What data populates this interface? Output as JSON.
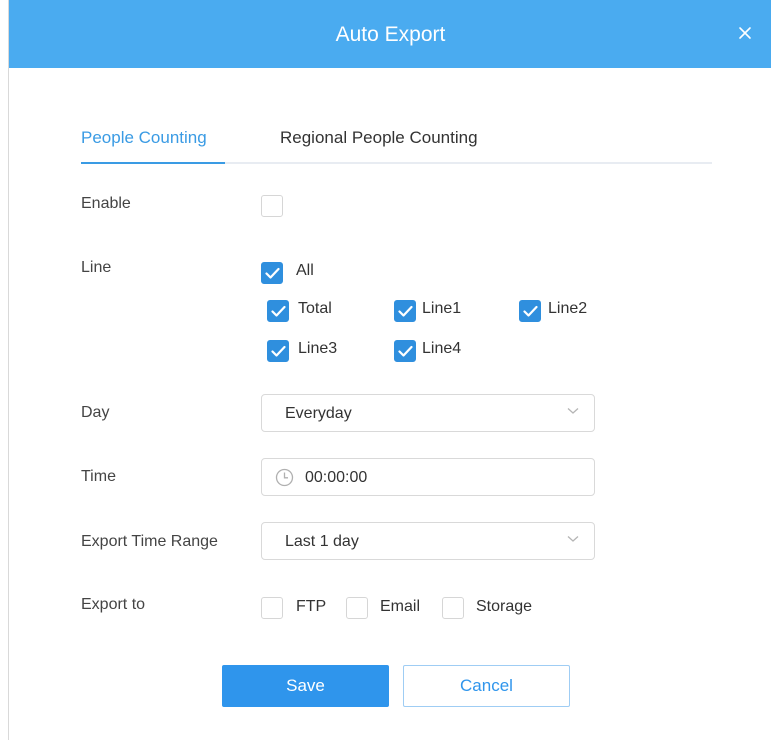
{
  "dialog": {
    "title": "Auto Export"
  },
  "tabs": [
    {
      "label": "People Counting",
      "active": true
    },
    {
      "label": "Regional People Counting",
      "active": false
    }
  ],
  "form": {
    "enable": {
      "label": "Enable",
      "checked": false
    },
    "line": {
      "label": "Line",
      "all": {
        "label": "All",
        "checked": true
      },
      "options": [
        {
          "label": "Total",
          "checked": true
        },
        {
          "label": "Line1",
          "checked": true
        },
        {
          "label": "Line2",
          "checked": true
        },
        {
          "label": "Line3",
          "checked": true
        },
        {
          "label": "Line4",
          "checked": true
        }
      ]
    },
    "day": {
      "label": "Day",
      "value": "Everyday"
    },
    "time": {
      "label": "Time",
      "value": "00:00:00",
      "icon": "clock-icon"
    },
    "export_range": {
      "label": "Export Time Range",
      "value": "Last 1 day"
    },
    "export_to": {
      "label": "Export to",
      "options": [
        {
          "label": "FTP",
          "checked": false
        },
        {
          "label": "Email",
          "checked": false
        },
        {
          "label": "Storage",
          "checked": false
        }
      ]
    }
  },
  "buttons": {
    "save": "Save",
    "cancel": "Cancel"
  },
  "colors": {
    "header": "#4aabf0",
    "accent": "#2f8fde",
    "active_tab": "#3a9be4"
  }
}
